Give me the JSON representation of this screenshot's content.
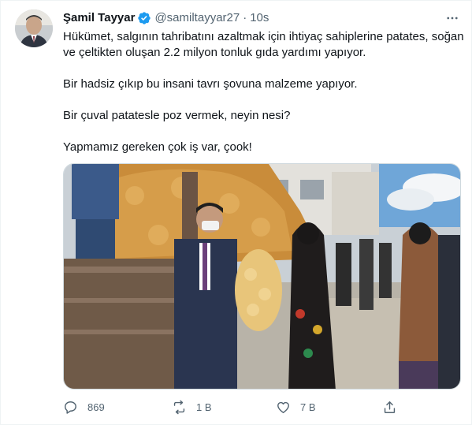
{
  "tweet": {
    "author_name": "Şamil Tayyar",
    "handle": "@samiltayyar27",
    "separator": "·",
    "time": "10s",
    "paragraphs": [
      "Hükümet, salgının tahribatını azaltmak için ihtiyaç sahiplerine patates, soğan ve çeltikten oluşan 2.2 milyon tonluk gıda yardımı yapıyor.",
      "Bir hadsiz çıkıp bu insani tavrı şovuna malzeme yapıyor.",
      "Bir çuval patatesle poz vermek, neyin nesi?",
      "Yapmamız gereken çok iş var, çook!"
    ]
  },
  "actions": {
    "reply_count": "869",
    "retweet_count": "1 B",
    "like_count": "7 B"
  },
  "icons": {
    "verified": "verified-badge-icon",
    "more": "more-icon",
    "reply": "reply-icon",
    "retweet": "retweet-icon",
    "like": "heart-icon",
    "share": "share-icon"
  },
  "colors": {
    "verified_blue": "#1d9bf0",
    "secondary_text": "#536471"
  }
}
